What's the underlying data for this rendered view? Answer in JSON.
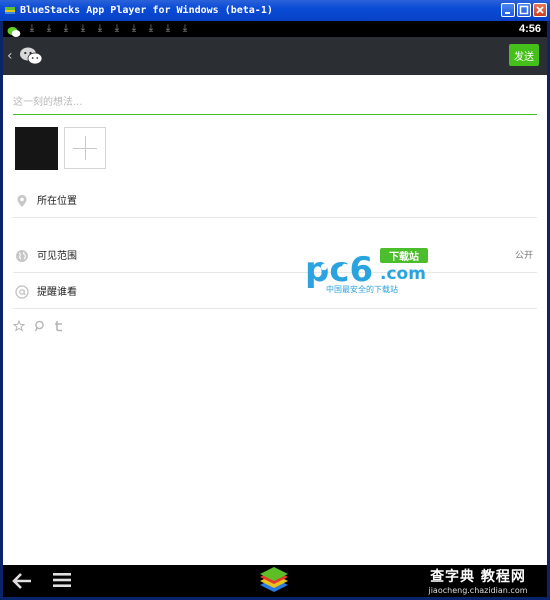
{
  "window": {
    "title": "BlueStacks App Player for Windows (beta-1)"
  },
  "statusbar": {
    "clock": "4:56",
    "download_icons": [
      "download-icon",
      "download-icon",
      "download-icon",
      "download-icon",
      "download-icon",
      "download-icon",
      "download-icon",
      "download-icon",
      "download-icon",
      "download-icon"
    ]
  },
  "actionbar": {
    "send_label": "发送"
  },
  "composer": {
    "placeholder": "这一刻的想法..."
  },
  "rows": {
    "location": {
      "label": "所在位置"
    },
    "visibility": {
      "label": "可见范围",
      "value": "公开"
    },
    "remind": {
      "label": "提醒谁看"
    }
  },
  "watermark": {
    "pc6_badge": "下载站",
    "pc6_com": ".com",
    "pc6_slogan": "中国最安全的下载站",
    "corner_top": "查字典 教程网",
    "corner_bottom": "jiaocheng.chazidian.com"
  },
  "colors": {
    "accent_green": "#45c01a",
    "actionbar": "#2b2e33",
    "title_blue": "#0a4bd6"
  }
}
